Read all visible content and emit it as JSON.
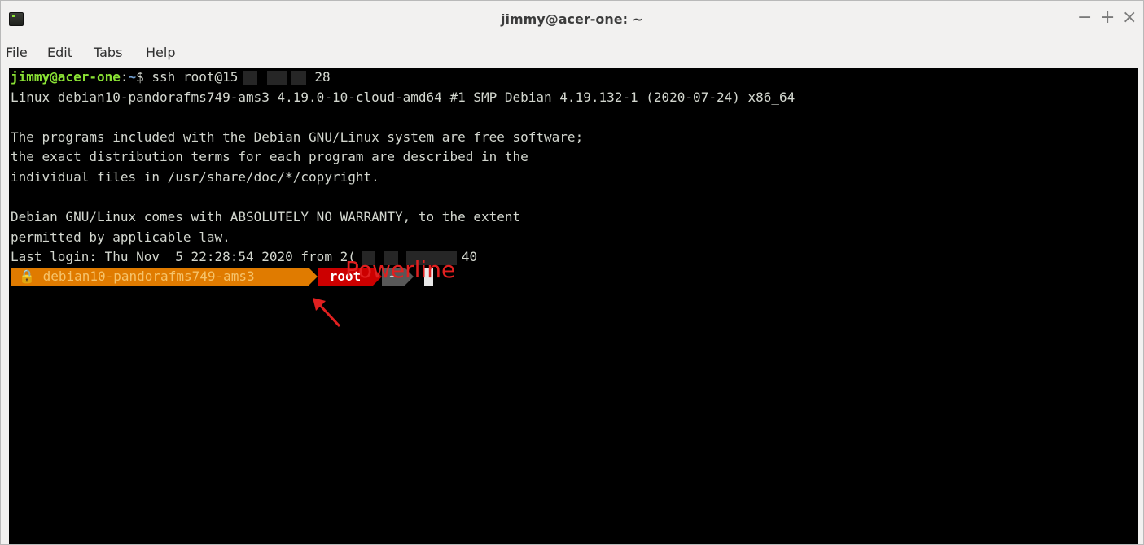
{
  "window": {
    "title": "jimmy@acer-one: ~",
    "controls": {
      "minimize": "−",
      "maximize": "+",
      "close": "×"
    }
  },
  "menubar": {
    "items": [
      "File",
      "Edit",
      "Tabs",
      "Help"
    ]
  },
  "terminal": {
    "prompt_user_host": "jimmy@acer-one",
    "prompt_sep": ":",
    "prompt_path": "~",
    "prompt_dollar": "$ ",
    "command_prefix": "ssh root@15",
    "command_suffix": "28",
    "lines": [
      "Linux debian10-pandorafms749-ams3 4.19.0-10-cloud-amd64 #1 SMP Debian 4.19.132-1 (2020-07-24) x86_64",
      "",
      "The programs included with the Debian GNU/Linux system are free software;",
      "the exact distribution terms for each program are described in the",
      "individual files in /usr/share/doc/*/copyright.",
      "",
      "Debian GNU/Linux comes with ABSOLUTELY NO WARRANTY, to the extent",
      "permitted by applicable law."
    ],
    "last_login_prefix": "Last login: Thu Nov  5 22:28:54 2020 from 2(",
    "last_login_suffix": "40",
    "powerline": {
      "host_icon": "🔒",
      "host": "debian10-pandorafms749-ams3",
      "user": "root",
      "cwd": "~"
    }
  },
  "annotation": {
    "label": "Powerline"
  },
  "colors": {
    "terminal_bg": "#000000",
    "terminal_fg": "#d3d7cf",
    "prompt_user": "#8ae234",
    "prompt_path": "#729fcf",
    "powerline_host_bg": "#e07b00",
    "powerline_user_bg": "#cc0000",
    "powerline_cwd_bg": "#585858",
    "annotation": "#e02020"
  }
}
